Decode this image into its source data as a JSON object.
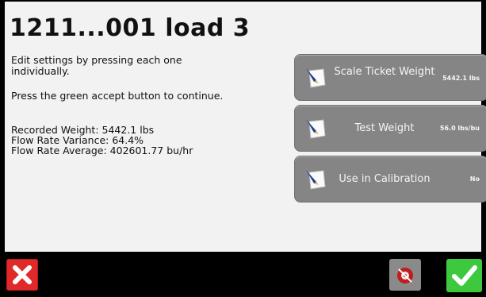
{
  "header": {
    "title": "1211...001 load 3"
  },
  "instructions": {
    "line1": "Edit settings by pressing each one individually.",
    "line2": "Press the green accept button to continue."
  },
  "stats": {
    "recorded_weight": "Recorded Weight: 5442.1 lbs",
    "flow_rate_variance": "Flow Rate Variance: 64.4%",
    "flow_rate_average": "Flow Rate Average: 402601.77 bu/hr"
  },
  "settings": [
    {
      "label": "Scale Ticket Weight",
      "value": "5442.1 lbs",
      "icon": "edit-pencil-icon"
    },
    {
      "label": "Test Weight",
      "value": "56.0 lbs/bu",
      "icon": "edit-pencil-icon"
    },
    {
      "label": "Use in Calibration",
      "value": "No",
      "icon": "edit-pencil-icon"
    }
  ],
  "footer": {
    "cancel_icon": "close-x-icon",
    "middle_icon": "no-steering-icon",
    "accept_icon": "checkmark-icon"
  },
  "colors": {
    "cancel": "#e02a2a",
    "accept": "#3dc83d",
    "setting_button": "#858585",
    "background": "#f2f2f2"
  }
}
